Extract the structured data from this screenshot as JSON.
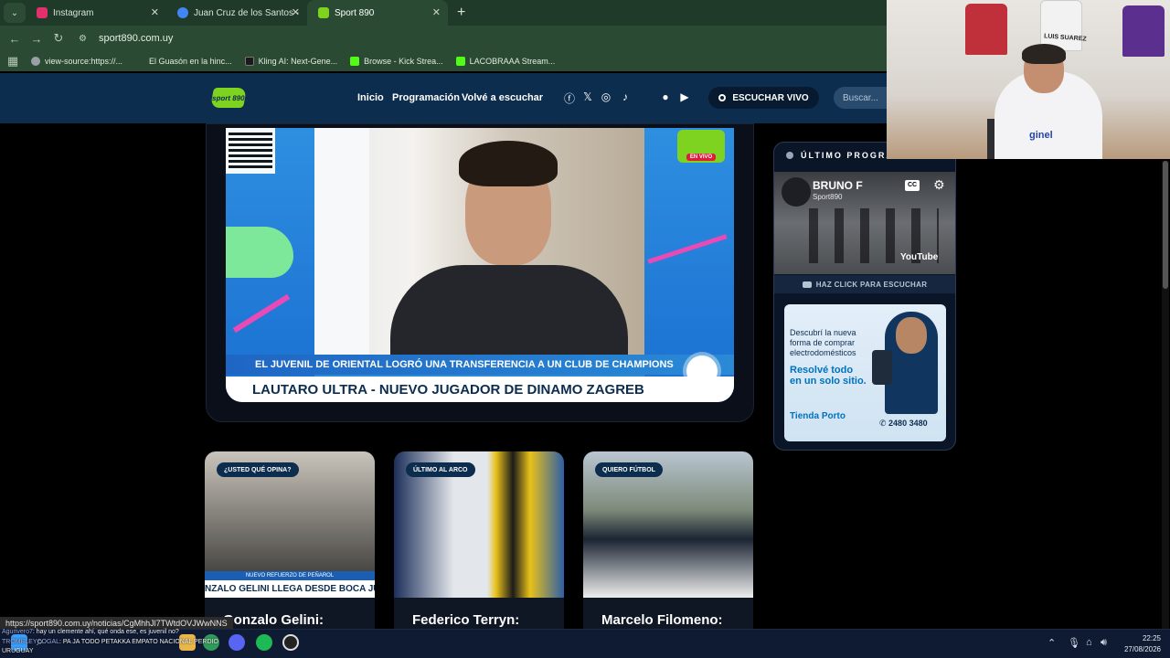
{
  "browser": {
    "tabs": [
      {
        "title": "Instagram",
        "favicon_color": "#e1306c",
        "active": false
      },
      {
        "title": "Juan Cruz de los Santos - Busca",
        "favicon_color": "#4285f4",
        "active": false
      },
      {
        "title": "Sport 890",
        "favicon_color": "#7ed321",
        "active": true
      }
    ],
    "new_tab_label": "+",
    "url": "sport890.com.uy",
    "bookmarks": [
      {
        "label": "view-source:https://...",
        "icon_color": "#9aa0a6"
      },
      {
        "label": "El Guasón en la hinc...",
        "icon_color": "#2a4a33"
      },
      {
        "label": "Kling AI: Next-Gene...",
        "icon_color": "#1a1a1a"
      },
      {
        "label": "Browse - Kick Strea...",
        "icon_color": "#53fc18"
      },
      {
        "label": "LACOBRAAA Stream...",
        "icon_color": "#53fc18"
      }
    ]
  },
  "site": {
    "logo_text": "sport 890",
    "nav": [
      "Inicio",
      "Programación",
      "Volvé a escuchar"
    ],
    "social_icons": [
      "facebook-icon",
      "x-icon",
      "instagram-icon",
      "tiktok-icon",
      "apple-icon",
      "google-play-icon"
    ],
    "live_button": "ESCUCHAR VIVO",
    "search_placeholder": "Buscar...",
    "accent": "#7ed321",
    "header_bg": "#0d2d4f"
  },
  "hero": {
    "badge_text": "sport 890",
    "badge_live": "EN VIVO",
    "lower_third_top": "EL JUVENIL DE ORIENTAL LOGRÓ UNA TRANSFERENCIA A UN CLUB DE CHAMPIONS",
    "lower_third_main": "LAUTARO ULTRA - NUEVO JUGADOR DE DINAMO ZAGREB"
  },
  "sidebar": {
    "heading": "ÚLTIMO PROGRAMA",
    "video_title": "BRUNO F",
    "video_channel": "Sport890",
    "cc_label": "CC",
    "youtube_label": "YouTube",
    "listen_label": "HAZ CLICK PARA ESCUCHAR",
    "ad": {
      "line1": "Descubrí la nueva forma de comprar electrodomésticos",
      "line2": "Resolvé todo en un solo sitio.",
      "brand": "Tienda Porto",
      "phone": "2480 3480"
    }
  },
  "news": [
    {
      "tag": "¿USTED QUÉ OPINA?",
      "title": "Gonzalo Gelini:",
      "caption_small": "NUEVO REFUERZO DE PEÑAROL",
      "caption_big": "NZALO GELINI LLEGA DESDE BOCA JUNIO"
    },
    {
      "tag": "ÚLTIMO AL ARCO",
      "title": "Federico Terryn:"
    },
    {
      "tag": "QUIERO FÚTBOL",
      "title": "Marcelo Filomeno:"
    }
  ],
  "webcam": {
    "jersey_label": "LUIS SUAREZ",
    "sponsor": "ginel"
  },
  "status_link": "https://sport890.com.uy/noticias/CgMhhJl7TWtdOVJWwNNS",
  "chat": [
    {
      "user": "Agurivero7",
      "text": ": hay un clemente ahí, qué onda ese, es juvenil no?"
    },
    {
      "user": "TROMBLEYCOGAL",
      "text": ": PA JA TODO PETAKKA EMPATO NACIONAL PERDIO"
    },
    {
      "user": "",
      "text": "URUGUAY"
    }
  ],
  "taskbar": {
    "time": "22:25",
    "date": "27/08/2026"
  }
}
